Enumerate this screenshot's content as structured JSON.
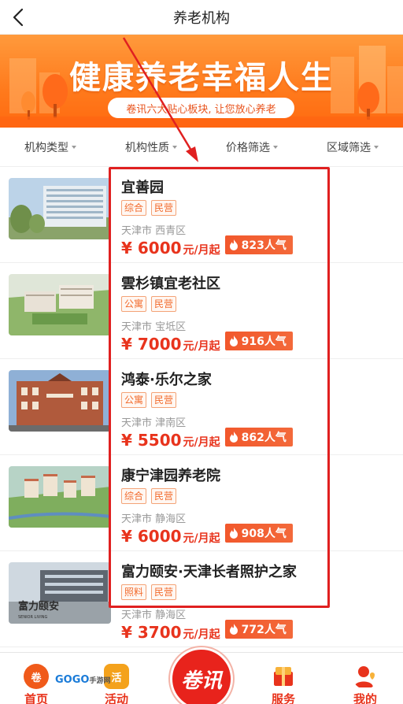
{
  "header": {
    "title": "养老机构"
  },
  "banner": {
    "title": "健康养老幸福人生",
    "subtitle": "卷讯六大贴心板块, 让您放心养老"
  },
  "filters": [
    {
      "label": "机构类型"
    },
    {
      "label": "机构性质"
    },
    {
      "label": "价格筛选"
    },
    {
      "label": "区域筛选"
    }
  ],
  "listings": [
    {
      "name": "宜善园",
      "tags": [
        "综合",
        "民营"
      ],
      "location": "天津市 西青区",
      "price": "¥ 6000",
      "unit": "元/月起",
      "popularity": "823人气"
    },
    {
      "name": "雲杉镇宜老社区",
      "tags": [
        "公寓",
        "民营"
      ],
      "location": "天津市 宝坻区",
      "price": "¥ 7000",
      "unit": "元/月起",
      "popularity": "916人气"
    },
    {
      "name": "鸿泰·乐尔之家",
      "tags": [
        "公寓",
        "民营"
      ],
      "location": "天津市 津南区",
      "price": "¥ 5500",
      "unit": "元/月起",
      "popularity": "862人气"
    },
    {
      "name": "康宁津园养老院",
      "tags": [
        "综合",
        "民营"
      ],
      "location": "天津市 静海区",
      "price": "¥ 6000",
      "unit": "元/月起",
      "popularity": "908人气"
    },
    {
      "name": "富力颐安·天津长者照护之家",
      "tags": [
        "照料",
        "民营"
      ],
      "location": "天津市 静海区",
      "price": "¥ 3700",
      "unit": "元/月起",
      "popularity": "772人气"
    }
  ],
  "thumb_caption": {
    "text": "富力颐安",
    "sub": "SENIOR LIVING"
  },
  "bottom_nav": {
    "home": {
      "label": "首页",
      "icon": "卷"
    },
    "activity": {
      "label": "活动",
      "icon": "活"
    },
    "center": {
      "label": "卷讯"
    },
    "service": {
      "label": "服务"
    },
    "mine": {
      "label": "我的"
    }
  },
  "watermark": {
    "text": "GOGO",
    "sub": "手游网"
  },
  "colors": {
    "accent": "#e8331c",
    "banner": "#ff7a1c",
    "highlight": "#e02020",
    "tag": "#f26a2b"
  }
}
